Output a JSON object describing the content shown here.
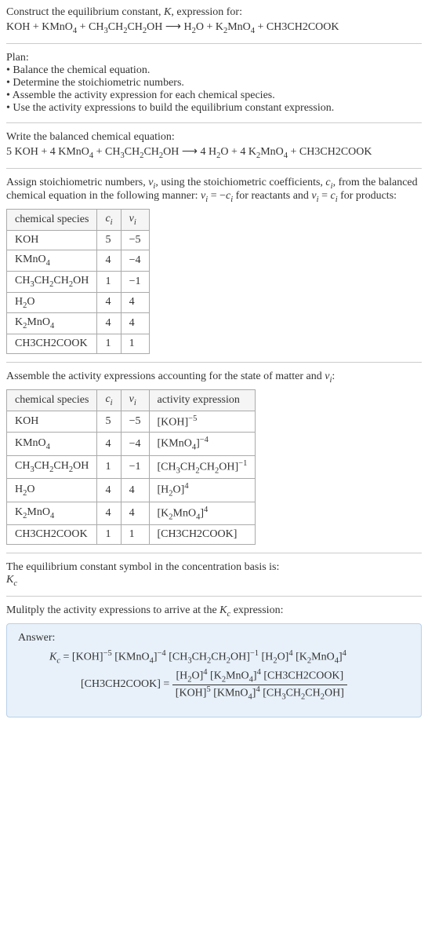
{
  "intro": {
    "line1_a": "Construct the equilibrium constant, ",
    "line1_K": "K",
    "line1_b": ", expression for:",
    "eq_lhs_a": "KOH + KMnO",
    "eq_lhs_b": " + CH",
    "eq_lhs_c": "CH",
    "eq_lhs_d": "CH",
    "eq_lhs_e": "OH",
    "arrow": " ⟶ ",
    "eq_rhs_a": "H",
    "eq_rhs_b": "O + K",
    "eq_rhs_c": "MnO",
    "eq_rhs_d": " + CH3CH2COOK"
  },
  "plan": {
    "heading": "Plan:",
    "b1": "• Balance the chemical equation.",
    "b2": "• Determine the stoichiometric numbers.",
    "b3": "• Assemble the activity expression for each chemical species.",
    "b4": "• Use the activity expressions to build the equilibrium constant expression."
  },
  "balanced": {
    "heading": "Write the balanced chemical equation:",
    "lhs_a": "5 KOH + 4 KMnO",
    "lhs_b": " + CH",
    "lhs_c": "CH",
    "lhs_d": "CH",
    "lhs_e": "OH",
    "arrow": " ⟶ ",
    "rhs_a": "4 H",
    "rhs_b": "O + 4 K",
    "rhs_c": "MnO",
    "rhs_d": " + CH3CH2COOK"
  },
  "assign": {
    "text_a": "Assign stoichiometric numbers, ",
    "nu": "ν",
    "text_b": ", using the stoichiometric coefficients, ",
    "c": "c",
    "text_c": ", from the balanced chemical equation in the following manner: ",
    "eq1_a": "ν",
    "eq1_b": " = −",
    "eq1_c": "c",
    "text_d": " for reactants and ",
    "eq2_a": "ν",
    "eq2_b": " = ",
    "eq2_c": "c",
    "text_e": " for products:"
  },
  "table1": {
    "h1": "chemical species",
    "h2": "c",
    "h3": "ν",
    "r1c1": "KOH",
    "r1c2": "5",
    "r1c3": "−5",
    "r2c1": "KMnO",
    "r2c2": "4",
    "r2c3": "−4",
    "r3c1": "CH",
    "r3c2": "1",
    "r3c3": "−1",
    "r4c1": "H",
    "r4c2": "4",
    "r4c3": "4",
    "r5c1": "K",
    "r5c2": "4",
    "r5c3": "4",
    "r6c1": "CH3CH2COOK",
    "r6c2": "1",
    "r6c3": "1"
  },
  "assemble": {
    "text_a": "Assemble the activity expressions accounting for the state of matter and ",
    "nu": "ν",
    "text_b": ":"
  },
  "table2": {
    "h1": "chemical species",
    "h2": "c",
    "h3": "ν",
    "h4": "activity expression",
    "r1c1": "KOH",
    "r1c2": "5",
    "r1c3": "−5",
    "r1a": "[KOH]",
    "r1e": "−5",
    "r2c1": "KMnO",
    "r2c2": "4",
    "r2c3": "−4",
    "r2a": "[KMnO",
    "r2a2": "]",
    "r2e": "−4",
    "r3c1": "CH",
    "r3c2": "1",
    "r3c3": "−1",
    "r3a": "[CH",
    "r3a2": "CH",
    "r3a3": "CH",
    "r3a4": "OH]",
    "r3e": "−1",
    "r4c1": "H",
    "r4c2": "4",
    "r4c3": "4",
    "r4a": "[H",
    "r4a2": "O]",
    "r4e": "4",
    "r5c1": "K",
    "r5c2": "4",
    "r5c3": "4",
    "r5a": "[K",
    "r5a2": "MnO",
    "r5a3": "]",
    "r5e": "4",
    "r6c1": "CH3CH2COOK",
    "r6c2": "1",
    "r6c3": "1",
    "r6a": "[CH3CH2COOK]"
  },
  "eqconst": {
    "line1": "The equilibrium constant symbol in the concentration basis is:",
    "K": "K",
    "c": "c"
  },
  "multiply": {
    "text_a": "Mulitply the activity expressions to arrive at the ",
    "K": "K",
    "c": "c",
    "text_b": " expression:"
  },
  "answer": {
    "heading": "Answer:",
    "Kc_K": "K",
    "Kc_c": "c",
    "eq": " = ",
    "t1": "[KOH]",
    "e1": "−5",
    "t2": " [KMnO",
    "e2": "−4",
    "t3": " [CH",
    "t3b": "CH",
    "t3c": "CH",
    "t3d": "OH]",
    "e3": "−1",
    "t4": " [H",
    "t4b": "O]",
    "e4": "4",
    "t5": " [K",
    "t5b": "MnO",
    "t5c": "]",
    "e5": "4",
    "line2_a": "[CH3CH2COOK] = ",
    "num_a": "[H",
    "num_b": "O]",
    "ne1": "4",
    "num_c": " [K",
    "num_d": "MnO",
    "num_e": "]",
    "ne2": "4",
    "num_f": " [CH3CH2COOK]",
    "den_a": "[KOH]",
    "de1": "5",
    "den_b": " [KMnO",
    "den_c": "]",
    "de2": "4",
    "den_d": " [CH",
    "den_e": "CH",
    "den_f": "CH",
    "den_g": "OH]"
  },
  "sub4": "4",
  "sub3": "3",
  "sub2": "2",
  "subi": "i"
}
